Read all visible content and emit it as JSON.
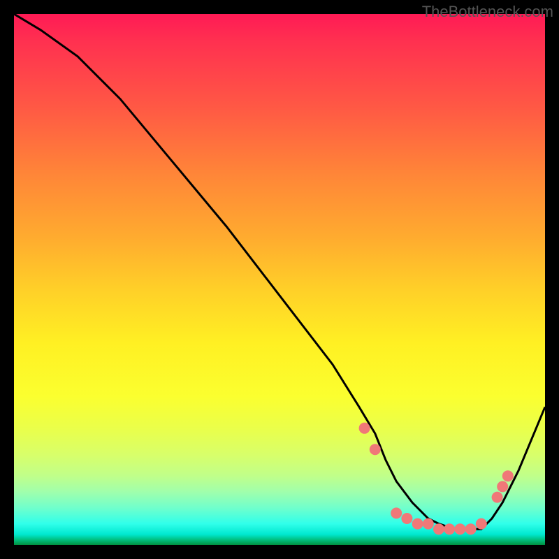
{
  "watermark": "TheBottleneck.com",
  "chart_data": {
    "type": "line",
    "title": "",
    "xlabel": "",
    "ylabel": "",
    "xlim": [
      0,
      100
    ],
    "ylim": [
      0,
      100
    ],
    "grid": false,
    "series": [
      {
        "name": "curve",
        "x": [
          0,
          5,
          12,
          20,
          30,
          40,
          50,
          60,
          65,
          68,
          70,
          72,
          75,
          78,
          80,
          83,
          85,
          88,
          90,
          92,
          95,
          100
        ],
        "values": [
          100,
          97,
          92,
          84,
          72,
          60,
          47,
          34,
          26,
          21,
          16,
          12,
          8,
          5,
          4,
          3,
          3,
          3,
          5,
          8,
          14,
          26
        ]
      }
    ],
    "markers": [
      {
        "x": 66,
        "y": 22
      },
      {
        "x": 68,
        "y": 18
      },
      {
        "x": 72,
        "y": 6
      },
      {
        "x": 74,
        "y": 5
      },
      {
        "x": 76,
        "y": 4
      },
      {
        "x": 78,
        "y": 4
      },
      {
        "x": 80,
        "y": 3
      },
      {
        "x": 82,
        "y": 3
      },
      {
        "x": 84,
        "y": 3
      },
      {
        "x": 86,
        "y": 3
      },
      {
        "x": 88,
        "y": 4
      },
      {
        "x": 91,
        "y": 9
      },
      {
        "x": 92,
        "y": 11
      },
      {
        "x": 93,
        "y": 13
      }
    ],
    "background_gradient": {
      "top": "#ff1a55",
      "mid": "#fff023",
      "bottom": "#009040"
    }
  }
}
